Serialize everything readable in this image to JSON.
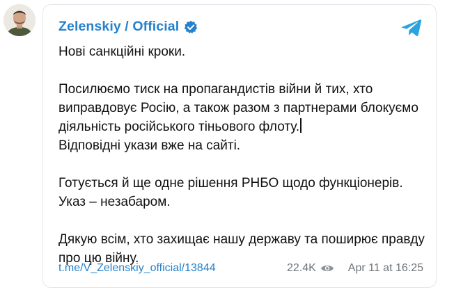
{
  "post": {
    "channel": "Zelenskiy / Official",
    "paragraphs": [
      "Нові санкційні кроки.",
      "Посилюємо тиск на пропагандистів війни й тих, хто виправдовує Росію, а також разом з партнерами блокуємо діяльність російського тіньового флоту.",
      "Відповідні укази вже на сайті.",
      "Готується й ще одне рішення РНБО щодо функціонерів. Указ – незабаром.",
      "Дякую всім, хто захищає нашу державу та поширює правду про цю війну."
    ],
    "link": "t.me/V_Zelenskiy_official/13844",
    "views": "22.4K",
    "date": "Apr 11 at 16:25"
  },
  "colors": {
    "accent": "#2481cc",
    "meta": "#707579"
  },
  "icons": {
    "verified": "verified-badge-icon",
    "telegram": "telegram-plane-icon",
    "views": "eye-icon"
  }
}
